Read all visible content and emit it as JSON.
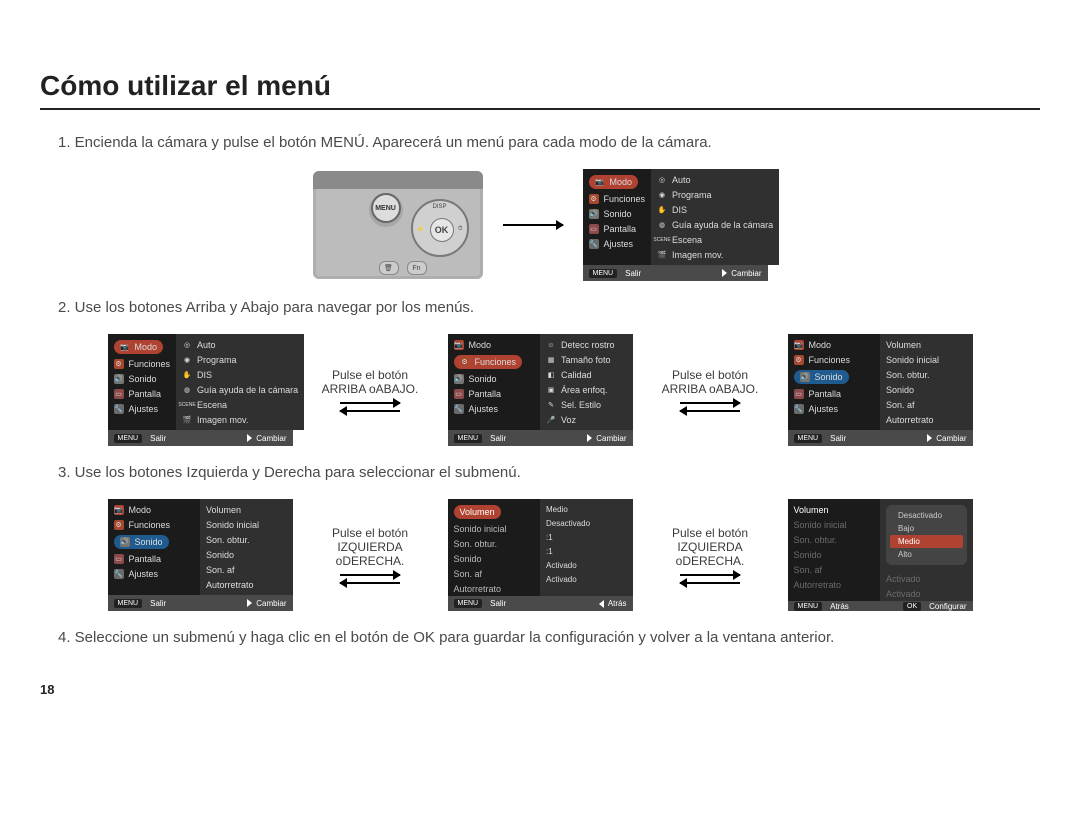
{
  "title": "Cómo utilizar el menú",
  "steps": {
    "s1": "1. Encienda la cámara y pulse el botón MENÚ. Aparecerá un menú para cada modo de la cámara.",
    "s2": "2. Use los botones Arriba y Abajo para navegar por los menús.",
    "s3": "3. Use los botones Izquierda y Derecha para seleccionar el submenú.",
    "s4": "4. Seleccione un submenú y haga clic en el botón de OK para guardar la configuración y volver a la ventana anterior."
  },
  "camera": {
    "menu": "MENU",
    "ok": "OK",
    "disp": "DISP",
    "flash": "⚡",
    "timer": "⏱",
    "fn": "Fn",
    "del": "🗑"
  },
  "menu_main_left": [
    "Modo",
    "Funciones",
    "Sonido",
    "Pantalla",
    "Ajustes"
  ],
  "menu_main_right": [
    "Auto",
    "Programa",
    "DIS",
    "Guía ayuda de la cámara",
    "Escena",
    "Imagen mov."
  ],
  "menu_func_right": [
    "Detecc rostro",
    "Tamaño foto",
    "Calidad",
    "Área enfoq.",
    "Sel. Estilo",
    "Voz"
  ],
  "menu_sound_right": [
    "Volumen",
    "Sonido inicial",
    "Son. obtur.",
    "Sonido",
    "Son. af",
    "Autorretrato"
  ],
  "menu_vol_left": [
    "Volumen",
    "Sonido inicial",
    "Son. obtur.",
    "Sonido",
    "Son. af",
    "Autorretrato"
  ],
  "menu_vol_right": [
    "Medio",
    "Desactivado",
    ":1",
    ":1",
    "Activado",
    "Activado"
  ],
  "menu_vol_options": [
    "Desactivado",
    "Bajo",
    "Medio",
    "Alto"
  ],
  "footer": {
    "menu_tag": "MENU",
    "salir": "Salir",
    "cambiar": "Cambiar",
    "atras": "Atrás",
    "ok": "OK",
    "config": "Configurar"
  },
  "hints": {
    "updown": "Pulse el botón ARRIBA oABAJO.",
    "leftright": "Pulse el botón IZQUIERDA oDERECHA."
  },
  "pagenum": "18"
}
